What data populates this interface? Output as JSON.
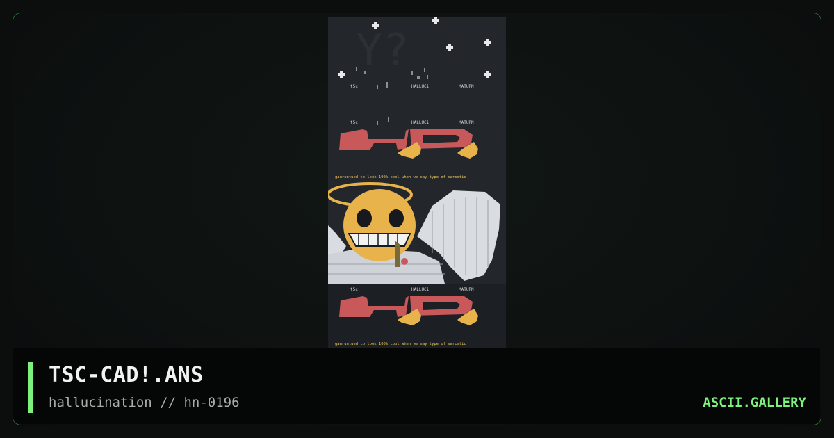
{
  "artwork": {
    "labels_top": [
      "t5c",
      "HALLUCi",
      "MATURN"
    ],
    "labels_mid": [
      "t5c",
      "HALLUCi",
      "MATURN"
    ],
    "labels_low": [
      "t5c",
      "HALLUCi",
      "MATURN"
    ],
    "tagline_1": "gauruntued to look 100% cool   when we say type of sarcstic",
    "tagline_2": "gauruntued to look 100% cool   when we say type of sarcstic",
    "palette": {
      "red": "#c9585a",
      "gold": "#e8b34a",
      "white": "#d9dce1",
      "ink": "#161a1e"
    }
  },
  "caption": {
    "title": "TSC-CAD!.ANS",
    "subtitle": "hallucination // hn-0196",
    "brand": "ASCII.GALLERY"
  },
  "colors": {
    "accent": "#7cf27d",
    "frame_border": "#2f6a31"
  }
}
